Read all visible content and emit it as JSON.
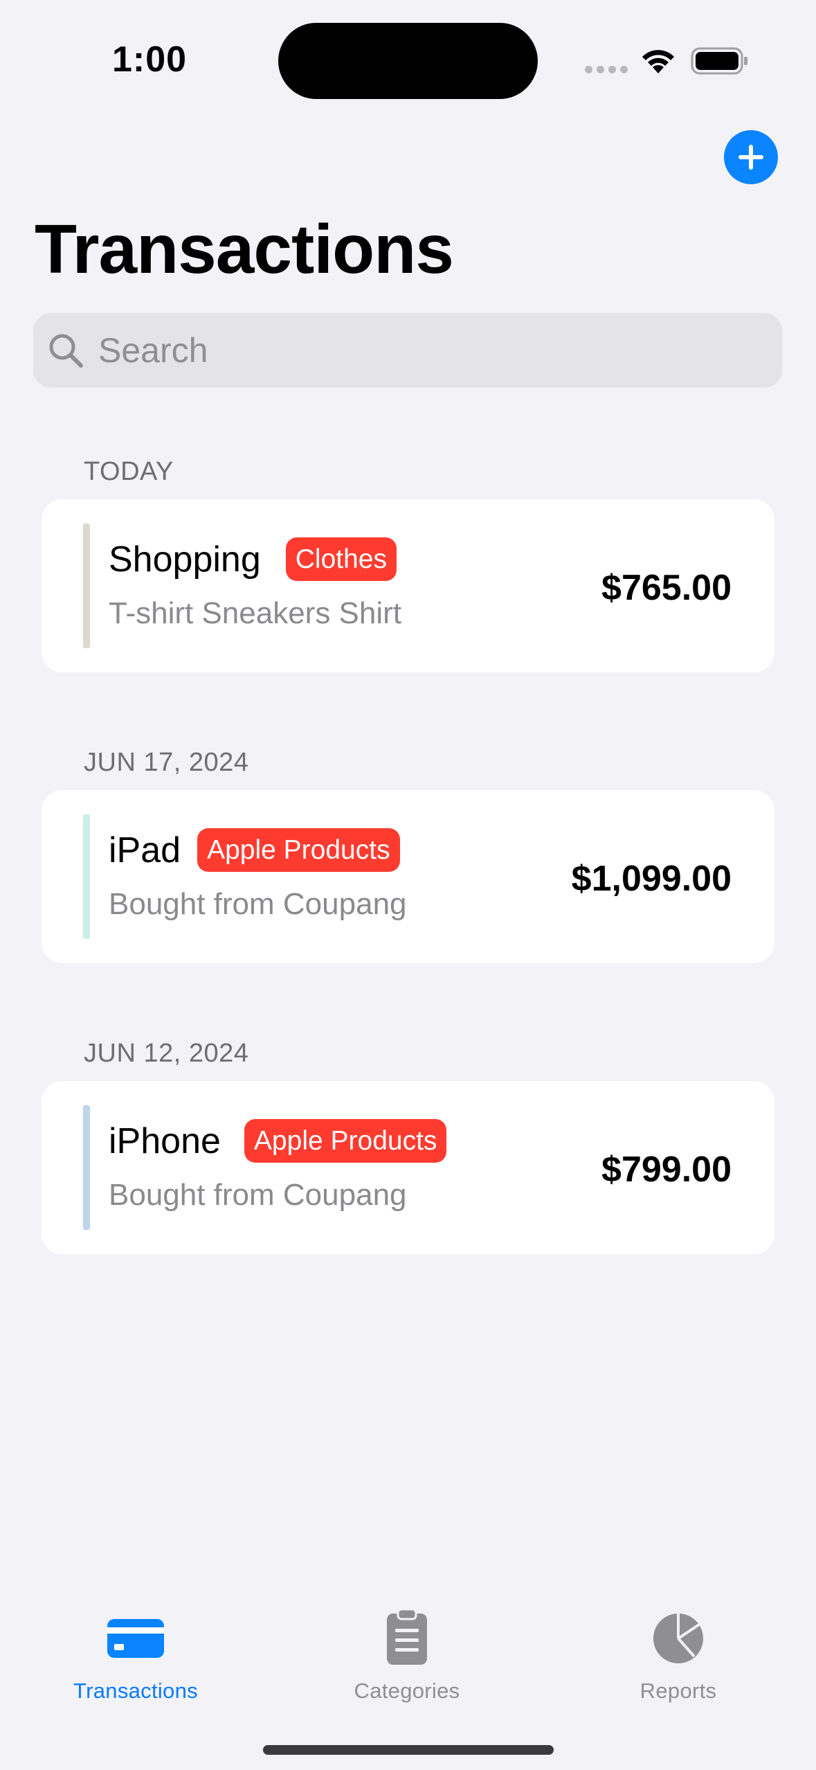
{
  "status_bar": {
    "time": "1:00"
  },
  "header": {
    "title": "Transactions",
    "add_icon": "plus-icon"
  },
  "search": {
    "placeholder": "Search",
    "value": ""
  },
  "sections": [
    {
      "header": "TODAY",
      "transaction": {
        "title": "Shopping",
        "category": "Clothes",
        "note": "T-shirt Sneakers Shirt",
        "amount": "$765.00",
        "accent_color": "#DCD8CC"
      }
    },
    {
      "header": "JUN 17, 2024",
      "transaction": {
        "title": "iPad",
        "category": "Apple Products",
        "note": "Bought from Coupang",
        "amount": "$1,099.00",
        "accent_color": "#C9EEEA"
      }
    },
    {
      "header": "JUN 12, 2024",
      "transaction": {
        "title": "iPhone",
        "category": "Apple Products",
        "note": "Bought from Coupang",
        "amount": "$799.00",
        "accent_color": "#BFD4EA"
      }
    }
  ],
  "tab_bar": {
    "tabs": [
      {
        "label": "Transactions",
        "icon": "credit-card-icon",
        "active": true
      },
      {
        "label": "Categories",
        "icon": "clipboard-icon",
        "active": false
      },
      {
        "label": "Reports",
        "icon": "pie-chart-icon",
        "active": false
      }
    ]
  },
  "colors": {
    "accent": "#0A84FF",
    "badge": "#FF3B30",
    "background": "#F2F2F7"
  }
}
